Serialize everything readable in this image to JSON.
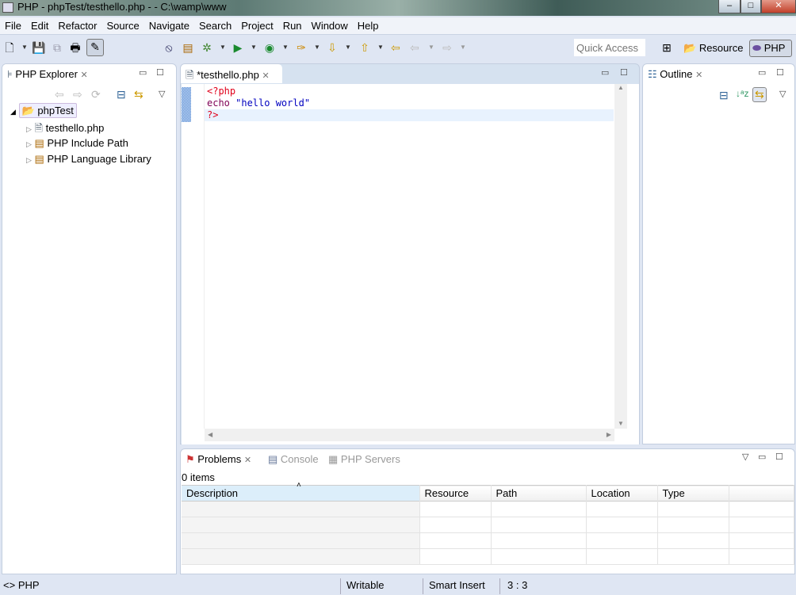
{
  "window": {
    "title": "PHP - phpTest/testhello.php -  - C:\\wamp\\www",
    "min": "–",
    "max": "□",
    "close": "✕"
  },
  "menu": [
    "File",
    "Edit",
    "Refactor",
    "Source",
    "Navigate",
    "Search",
    "Project",
    "Run",
    "Window",
    "Help"
  ],
  "toolbar": {
    "quick_access_placeholder": "Quick Access",
    "perspectives": [
      "Resource",
      "PHP"
    ],
    "active_perspective": "PHP"
  },
  "explorer": {
    "tab": "PHP Explorer",
    "project": "phpTest",
    "items": [
      "testhello.php",
      "PHP Include Path",
      "PHP Language Library"
    ]
  },
  "editor": {
    "tab": "*testhello.php",
    "lines": [
      {
        "parts": [
          {
            "t": "<?php",
            "c": "#e0001a"
          }
        ]
      },
      {
        "parts": [
          {
            "t": "echo",
            "c": "#7f0055"
          },
          {
            "t": " \"hello world\"",
            "c": "#0000c0"
          }
        ]
      },
      {
        "parts": [
          {
            "t": "?>",
            "c": "#e0001a"
          }
        ]
      }
    ]
  },
  "outline": {
    "tab": "Outline"
  },
  "bottom": {
    "tabs": [
      "Problems",
      "Console",
      "PHP Servers"
    ],
    "count": "0 items",
    "columns": [
      "Description",
      "Resource",
      "Path",
      "Location",
      "Type"
    ],
    "sort_indicator": "˄"
  },
  "status": {
    "left": "PHP",
    "writable": "Writable",
    "insert": "Smart Insert",
    "position": "3 : 3"
  },
  "colors": {
    "accent": "#dfe6f3",
    "current_line": "#e8f2fe"
  }
}
